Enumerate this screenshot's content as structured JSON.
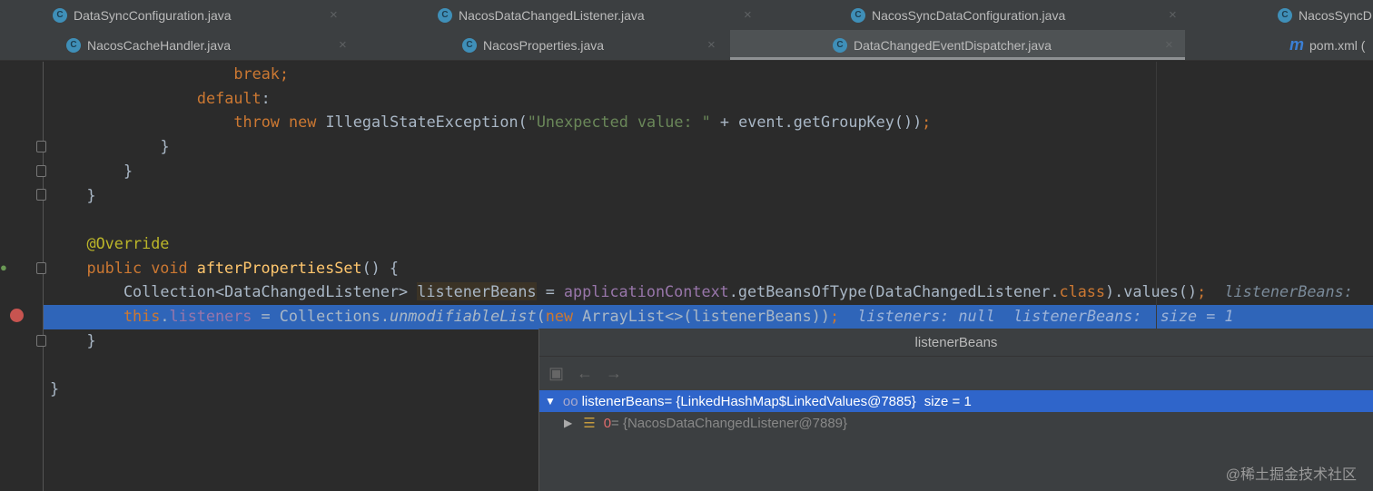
{
  "tabs_row1": [
    {
      "label": "DataSyncConfiguration.java",
      "icon": "class-icon"
    },
    {
      "label": "NacosDataChangedListener.java",
      "icon": "class-icon"
    },
    {
      "label": "NacosSyncDataConfiguration.java",
      "icon": "class-icon"
    },
    {
      "label": "NacosSyncD",
      "icon": "class-icon"
    }
  ],
  "tabs_row2": [
    {
      "label": "NacosCacheHandler.java",
      "icon": "class-icon"
    },
    {
      "label": "NacosProperties.java",
      "icon": "class-icon"
    },
    {
      "label": "DataChangedEventDispatcher.java",
      "icon": "class-icon",
      "active": true
    },
    {
      "label": "pom.xml (",
      "icon": "maven-icon"
    }
  ],
  "icon_letters": {
    "class": "C",
    "maven": "m",
    "close": "×"
  },
  "code": [
    [
      [
        "break;",
        "k"
      ]
    ],
    [
      [
        "default",
        "k"
      ],
      [
        ":",
        ""
      ]
    ],
    [
      [
        "throw new ",
        "k"
      ],
      [
        "IllegalStateException(",
        ""
      ],
      [
        "\"Unexpected value: \"",
        "s"
      ],
      [
        " + event.getGroupKey())",
        ""
      ],
      [
        ";",
        "k"
      ]
    ],
    [
      [
        "}",
        ""
      ]
    ],
    [
      [
        "}",
        ""
      ]
    ],
    [
      [
        "}",
        ""
      ]
    ],
    [],
    [
      [
        "@Override",
        "a"
      ]
    ],
    [
      [
        "public void ",
        "k"
      ],
      [
        "afterPropertiesSet",
        "f"
      ],
      [
        "() {",
        ""
      ]
    ],
    [
      [
        "Collection<DataChangedListener> ",
        ""
      ],
      [
        "listenerBeans",
        "hl"
      ],
      [
        " = ",
        ""
      ],
      [
        "applicationContext",
        "p"
      ],
      [
        ".getBeansOfType(DataChangedListener.",
        ""
      ],
      [
        "class",
        "k"
      ],
      [
        ").values()",
        ""
      ],
      [
        ";",
        "k"
      ],
      [
        "  listenerBeans: ",
        "h"
      ]
    ],
    [
      [
        "this",
        "k"
      ],
      [
        ".",
        ""
      ],
      [
        "listeners",
        "p"
      ],
      [
        " = Collections.",
        ""
      ],
      [
        "unmodifiableList",
        "i"
      ],
      [
        "(",
        ""
      ],
      [
        "new ",
        "k"
      ],
      [
        "ArrayList<>(listenerBeans))",
        ""
      ],
      [
        ";",
        "k"
      ],
      [
        "  listeners: null  listenerBeans: ",
        "h"
      ],
      [
        " size = 1",
        "h"
      ]
    ],
    [
      [
        "}",
        ""
      ]
    ],
    [],
    [
      [
        "}",
        ""
      ]
    ]
  ],
  "indents": [
    20,
    16,
    20,
    12,
    8,
    4,
    0,
    4,
    4,
    8,
    8,
    4,
    0,
    0
  ],
  "popup": {
    "title": "listenerBeans",
    "root": {
      "name": "listenerBeans",
      "value": " = {LinkedHashMap$LinkedValues@7885}",
      "size": "size = 1"
    },
    "child": {
      "index": "0",
      "value": " = {NacosDataChangedListener@7889}"
    }
  },
  "watermark": "@稀土掘金技术社区"
}
